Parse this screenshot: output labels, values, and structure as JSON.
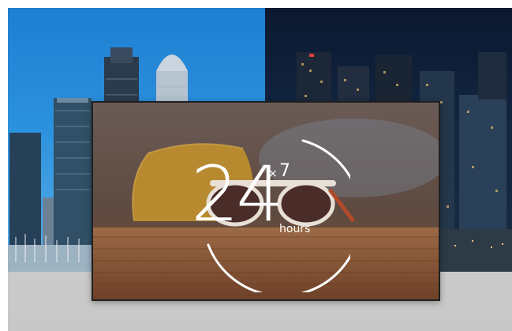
{
  "hero": {
    "badge": {
      "number": "24",
      "multiplier_symbol": "×",
      "multiplier": "7",
      "unit": "hours"
    }
  },
  "colors": {
    "sky_day": "#2b91de",
    "sky_night": "#0b1830",
    "badge_text": "#ffffff",
    "frame_border": "#202020"
  }
}
